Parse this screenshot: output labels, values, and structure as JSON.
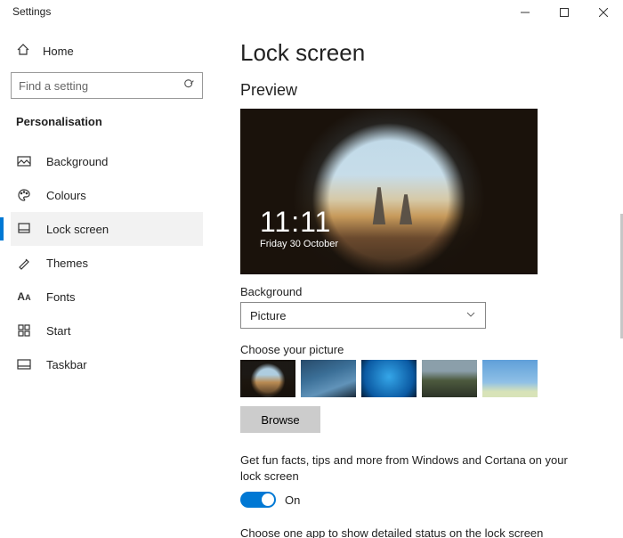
{
  "window": {
    "title": "Settings"
  },
  "sidebar": {
    "home": "Home",
    "search_placeholder": "Find a setting",
    "category": "Personalisation",
    "items": [
      {
        "label": "Background"
      },
      {
        "label": "Colours"
      },
      {
        "label": "Lock screen"
      },
      {
        "label": "Themes"
      },
      {
        "label": "Fonts"
      },
      {
        "label": "Start"
      },
      {
        "label": "Taskbar"
      }
    ]
  },
  "main": {
    "title": "Lock screen",
    "preview_heading": "Preview",
    "clock_time": "11:11",
    "clock_date": "Friday 30 October",
    "background_label": "Background",
    "background_value": "Picture",
    "choose_label": "Choose your picture",
    "browse": "Browse",
    "fun_facts": "Get fun facts, tips and more from Windows and Cortana on your lock screen",
    "toggle_state": "On",
    "detailed_status": "Choose one app to show detailed status on the lock screen"
  }
}
